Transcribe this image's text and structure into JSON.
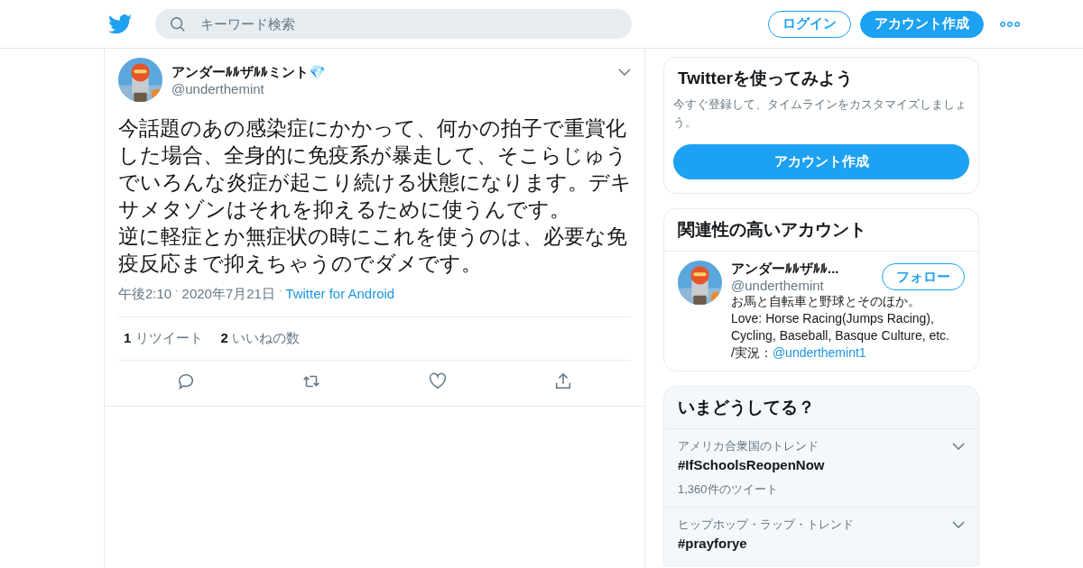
{
  "header": {
    "search": {
      "placeholder": "キーワード検索"
    },
    "login": "ログイン",
    "signup": "アカウント作成"
  },
  "tweet": {
    "name": "アンダーﾙﾙザﾙﾙミント💎",
    "handle": "@underthemint",
    "paragraphs": [
      "今話題のあの感染症にかかって、何かの拍子で重賞化した場合、全身的に免疫系が暴走して、そこらじゅうでいろんな炎症が起こり続ける状態になります。デキサメタゾンはそれを抑えるために使うんです。",
      "逆に軽症とか無症状の時にこれを使うのは、必要な免疫反応まで抑えちゃうのでダメです。"
    ],
    "time": "午後2:10",
    "separator": "·",
    "date": "2020年7月21日",
    "source": "Twitter for Android",
    "stats": [
      {
        "count": "1",
        "label": "リツイート"
      },
      {
        "count": "2",
        "label": "いいねの数"
      }
    ],
    "actions": [
      {
        "kind": "reply"
      },
      {
        "kind": "retweet"
      },
      {
        "kind": "like"
      },
      {
        "kind": "share"
      }
    ]
  },
  "signup_card": {
    "title": "Twitterを使ってみよう",
    "text": "今すぐ登録して、タイムラインをカスタマイズしましょう。",
    "button": "アカウント作成"
  },
  "related": {
    "title": "関連性の高いアカウント",
    "accounts": [
      {
        "name": "アンダーﾙﾙザﾙﾙ...",
        "handle": "@underthemint",
        "button": "フォロー",
        "bio": "お馬と自転車と野球とそのほか。\nLove: Horse Racing(Jumps Racing), Cycling, Baseball, Basque Culture, etc.\n/実況：",
        "bio_link": "@underthemint1"
      }
    ]
  },
  "trends": {
    "title": "いまどうしてる？",
    "items": [
      {
        "context": "アメリカ合衆国のトレンド",
        "tag": "#IfSchoolsReopenNow",
        "count": "1,360件のツイート"
      },
      {
        "context": "ヒップホップ・ラップ・トレンド",
        "tag": "#prayforye"
      }
    ]
  }
}
